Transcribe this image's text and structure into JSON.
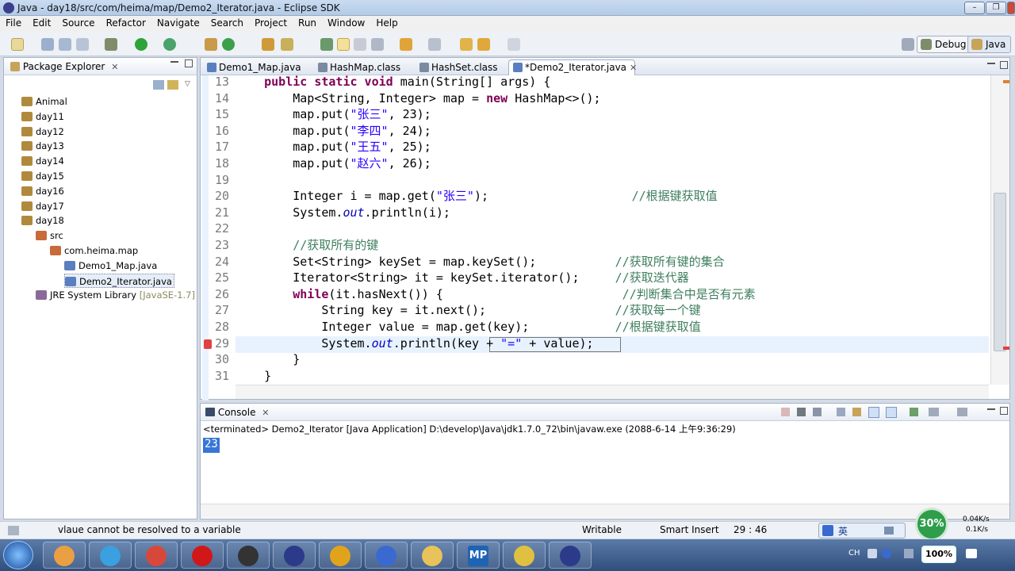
{
  "window": {
    "title": "Java - day18/src/com/heima/map/Demo2_Iterator.java - Eclipse SDK",
    "controls": [
      "–",
      "❐",
      "✕"
    ]
  },
  "menu": [
    "File",
    "Edit",
    "Source",
    "Refactor",
    "Navigate",
    "Search",
    "Project",
    "Run",
    "Window",
    "Help"
  ],
  "perspectives": {
    "debug": "Debug",
    "java": "Java"
  },
  "package_explorer": {
    "title": "Package Explorer",
    "items": [
      {
        "label": "Animal",
        "depth": 0,
        "icon_color": "#b08a3c"
      },
      {
        "label": "day11",
        "depth": 0,
        "icon_color": "#b08a3c"
      },
      {
        "label": "day12",
        "depth": 0,
        "icon_color": "#b08a3c"
      },
      {
        "label": "day13",
        "depth": 0,
        "icon_color": "#b08a3c"
      },
      {
        "label": "day14",
        "depth": 0,
        "icon_color": "#b08a3c"
      },
      {
        "label": "day15",
        "depth": 0,
        "icon_color": "#b08a3c"
      },
      {
        "label": "day16",
        "depth": 0,
        "icon_color": "#b08a3c"
      },
      {
        "label": "day17",
        "depth": 0,
        "icon_color": "#b08a3c"
      },
      {
        "label": "day18",
        "depth": 0,
        "icon_color": "#b08a3c"
      },
      {
        "label": "src",
        "depth": 1,
        "icon_color": "#c86a3a"
      },
      {
        "label": "com.heima.map",
        "depth": 2,
        "icon_color": "#c86a3a"
      },
      {
        "label": "Demo1_Map.java",
        "depth": 3,
        "icon_color": "#5a7fc0"
      },
      {
        "label": "Demo2_Iterator.java",
        "depth": 3,
        "icon_color": "#5a7fc0",
        "selected": true
      },
      {
        "label": "JRE System Library",
        "suffix": "[JavaSE-1.7]",
        "depth": 1,
        "icon_color": "#8a6a9a"
      }
    ]
  },
  "editor": {
    "tabs": [
      {
        "label": "Demo1_Map.java",
        "active": false
      },
      {
        "label": "HashMap.class",
        "active": false
      },
      {
        "label": "HashSet.class",
        "active": false
      },
      {
        "label": "*Demo2_Iterator.java",
        "active": true
      }
    ],
    "lines": [
      {
        "n": "13",
        "parts": [
          [
            "    ",
            ""
          ],
          [
            "public static void ",
            "kw"
          ],
          [
            "main(String[] args) {",
            ""
          ]
        ]
      },
      {
        "n": "14",
        "parts": [
          [
            "        Map<String, Integer> map = ",
            ""
          ],
          [
            "new ",
            "kw"
          ],
          [
            "HashMap<>();",
            ""
          ]
        ]
      },
      {
        "n": "15",
        "parts": [
          [
            "        map.put(",
            ""
          ],
          [
            "\"张三\"",
            "str"
          ],
          [
            ", 23);",
            ""
          ]
        ]
      },
      {
        "n": "16",
        "parts": [
          [
            "        map.put(",
            ""
          ],
          [
            "\"李四\"",
            "str"
          ],
          [
            ", 24);",
            ""
          ]
        ]
      },
      {
        "n": "17",
        "parts": [
          [
            "        map.put(",
            ""
          ],
          [
            "\"王五\"",
            "str"
          ],
          [
            ", 25);",
            ""
          ]
        ]
      },
      {
        "n": "18",
        "parts": [
          [
            "        map.put(",
            ""
          ],
          [
            "\"赵六\"",
            "str"
          ],
          [
            ", 26);",
            ""
          ]
        ]
      },
      {
        "n": "19",
        "parts": []
      },
      {
        "n": "20",
        "parts": [
          [
            "        Integer i = map.get(",
            ""
          ],
          [
            "\"张三\"",
            "str"
          ],
          [
            ");                    ",
            ""
          ],
          [
            "//根据键获取值",
            "cm"
          ]
        ]
      },
      {
        "n": "21",
        "parts": [
          [
            "        System.",
            ""
          ],
          [
            "out",
            "it"
          ],
          [
            ".println(i);",
            ""
          ]
        ]
      },
      {
        "n": "22",
        "parts": []
      },
      {
        "n": "23",
        "parts": [
          [
            "        ",
            ""
          ],
          [
            "//获取所有的键",
            "cm"
          ]
        ]
      },
      {
        "n": "24",
        "parts": [
          [
            "        Set<String> keySet = map.keySet();           ",
            ""
          ],
          [
            "//获取所有键的集合",
            "cm"
          ]
        ]
      },
      {
        "n": "25",
        "parts": [
          [
            "        Iterator<String> it = keySet.iterator();     ",
            ""
          ],
          [
            "//获取迭代器",
            "cm"
          ]
        ]
      },
      {
        "n": "26",
        "parts": [
          [
            "        ",
            ""
          ],
          [
            "while",
            "kw"
          ],
          [
            "(it.hasNext()) {                         ",
            ""
          ],
          [
            "//判断集合中是否有元素",
            "cm"
          ]
        ]
      },
      {
        "n": "27",
        "parts": [
          [
            "            String key = it.next();                  ",
            ""
          ],
          [
            "//获取每一个键",
            "cm"
          ]
        ]
      },
      {
        "n": "28",
        "parts": [
          [
            "            Integer value = map.get(key);            ",
            ""
          ],
          [
            "//根据键获取值",
            "cm"
          ]
        ]
      },
      {
        "n": "29",
        "parts": [
          [
            "            System.",
            ""
          ],
          [
            "out",
            "it"
          ],
          [
            ".println(key + ",
            ""
          ],
          [
            "\"=\"",
            "str"
          ],
          [
            " + value);",
            ""
          ]
        ]
      },
      {
        "n": "30",
        "parts": [
          [
            "        }",
            ""
          ]
        ]
      },
      {
        "n": "31",
        "parts": [
          [
            "    }",
            ""
          ]
        ]
      }
    ]
  },
  "console": {
    "title": "Console",
    "status": "<terminated> Demo2_Iterator [Java Application] D:\\develop\\Java\\jdk1.7.0_72\\bin\\javaw.exe (2088-6-14 上午9:36:29)",
    "output": "23"
  },
  "statusbar": {
    "message": "vlaue cannot be resolved to a variable",
    "mode": "Writable",
    "insert": "Smart Insert",
    "position": "29 : 46",
    "progress": "30%",
    "speed_up": "0.04K/s",
    "speed_down": "0.1K/s",
    "ime": "英",
    "zoom": "100%"
  },
  "taskbar": {
    "apps": [
      {
        "name": "paint-app",
        "color": "#e9a043"
      },
      {
        "name": "qq-app",
        "color": "#3aa0e0"
      },
      {
        "name": "pdf-app",
        "color": "#d8483a"
      },
      {
        "name": "opera-app",
        "color": "#d01818"
      },
      {
        "name": "tool-app",
        "color": "#333333"
      },
      {
        "name": "eclipse-app",
        "color": "#2c3a8a"
      },
      {
        "name": "chrome-app",
        "color": "#e2a31c"
      },
      {
        "name": "video-app",
        "color": "#3a6ad0"
      },
      {
        "name": "folder-app",
        "color": "#e8c25a"
      },
      {
        "name": "mp-app",
        "color": "#1e64b4",
        "label": "MP"
      },
      {
        "name": "help-app",
        "color": "#e0c040"
      },
      {
        "name": "eclipse2-app",
        "color": "#2c3a8a"
      }
    ]
  }
}
